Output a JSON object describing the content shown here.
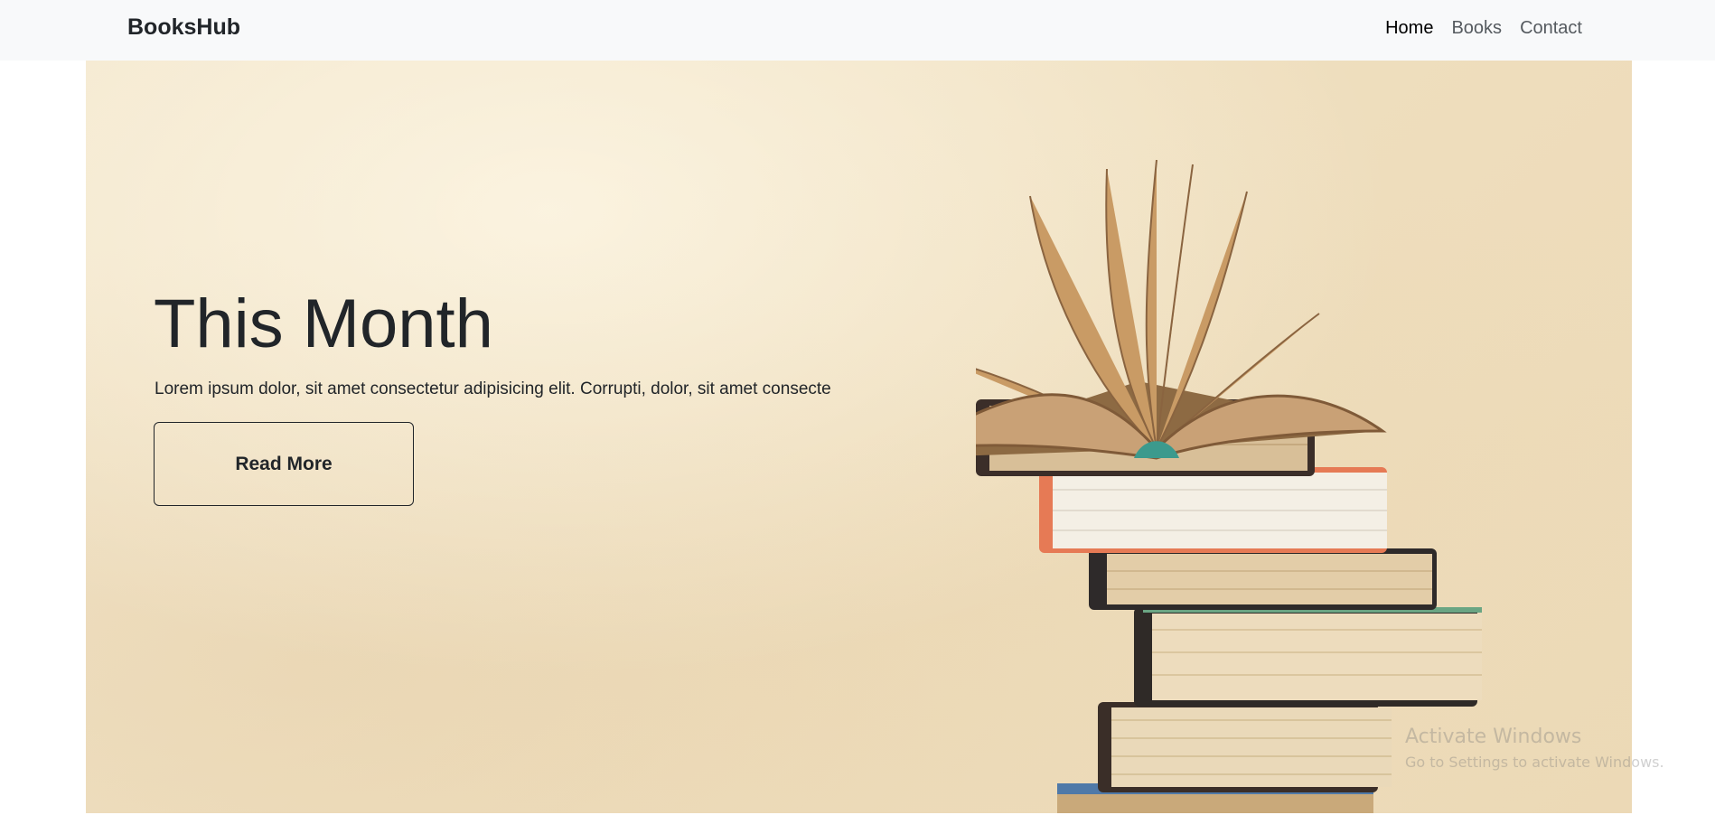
{
  "nav": {
    "brand": "BooksHub",
    "links": [
      "Home",
      "Books",
      "Contact"
    ],
    "active": "Home"
  },
  "hero": {
    "title": "This Month",
    "text": "Lorem ipsum dolor, sit amet consectetur adipisicing elit. Corrupti, dolor, sit amet consecte",
    "button_label": "Read More"
  },
  "watermark": {
    "title": "Activate Windows",
    "subtitle": "Go to Settings to activate Windows."
  },
  "colors": {
    "navbar_bg": "#f8f9fa",
    "text_dark": "#212529",
    "nav_link": "#555a5f",
    "hero_bg": "#efdfbf"
  }
}
